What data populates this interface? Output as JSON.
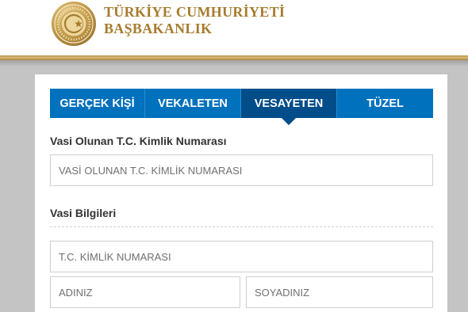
{
  "header": {
    "brand_line1": "TÜRKİYE CUMHURİYETİ",
    "brand_line2": "BAŞBAKANLIK",
    "seal_icon": "prime-ministry-seal-icon",
    "accent_color": "#a67c2e"
  },
  "tabs": {
    "items": [
      {
        "label": "GERÇEK KİŞİ",
        "active": false
      },
      {
        "label": "VEKALETEN",
        "active": false
      },
      {
        "label": "VESAYETEN",
        "active": true
      },
      {
        "label": "TÜZEL",
        "active": false
      }
    ],
    "color": "#0071bc",
    "active_color": "#004d8a"
  },
  "form": {
    "ward_section_label": "Vasi Olunan T.C. Kimlik Numarası",
    "ward_tc_placeholder": "VASİ OLUNAN T.C. KİMLİK NUMARASI",
    "guardian_section_label": "Vasi Bilgileri",
    "tc_placeholder": "T.C. KİMLİK NUMARASI",
    "name_placeholder": "ADINIZ",
    "surname_placeholder": "SOYADINIZ"
  }
}
